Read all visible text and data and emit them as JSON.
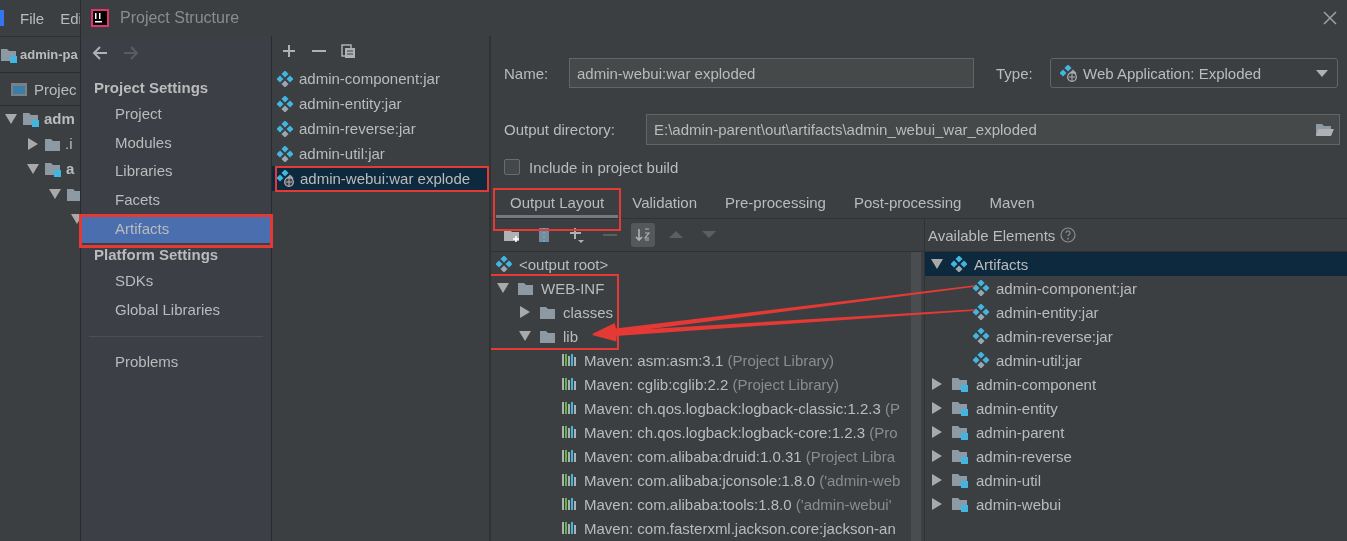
{
  "ide_background": {
    "menu": [
      "File",
      "Edi"
    ],
    "project_name": "admin-pa",
    "tool_window": "Projec",
    "tree": [
      {
        "label": "adm",
        "kind": "module",
        "expanded": true,
        "children": [
          {
            "label": ".i",
            "kind": "folder",
            "expanded": false
          },
          {
            "label": "a",
            "kind": "module",
            "expanded": true,
            "children": [
              {
                "kind": "folder",
                "expanded": true,
                "children": [
                  {
                    "expanded": true
                  }
                ]
              }
            ]
          }
        ]
      }
    ]
  },
  "dialog": {
    "title": "Project Structure"
  },
  "sidebar": {
    "nav": [
      {
        "kind": "back",
        "disabled": false
      },
      {
        "kind": "forward",
        "disabled": true
      }
    ],
    "sections": [
      {
        "heading": "Project Settings",
        "items": [
          {
            "label": "Project",
            "selected": false,
            "highlighted": false
          },
          {
            "label": "Modules",
            "selected": false,
            "highlighted": false
          },
          {
            "label": "Libraries",
            "selected": false,
            "highlighted": false
          },
          {
            "label": "Facets",
            "selected": false,
            "highlighted": false
          },
          {
            "label": "Artifacts",
            "selected": true,
            "highlighted": true
          }
        ]
      },
      {
        "heading": "Platform Settings",
        "items": [
          {
            "label": "SDKs",
            "selected": false,
            "highlighted": false
          },
          {
            "label": "Global Libraries",
            "selected": false,
            "highlighted": false
          }
        ]
      },
      {
        "items": [
          {
            "label": "Problems",
            "selected": false,
            "highlighted": false
          }
        ]
      }
    ]
  },
  "artifacts": {
    "toolbar": [
      {
        "kind": "add"
      },
      {
        "kind": "remove"
      },
      {
        "kind": "copy"
      }
    ],
    "items": [
      {
        "label": "admin-component:jar",
        "kind": "jar",
        "selected": false,
        "highlighted": false
      },
      {
        "label": "admin-entity:jar",
        "kind": "jar",
        "selected": false,
        "highlighted": false
      },
      {
        "label": "admin-reverse:jar",
        "kind": "jar",
        "selected": false,
        "highlighted": false
      },
      {
        "label": "admin-util:jar",
        "kind": "jar",
        "selected": false,
        "highlighted": false
      },
      {
        "label": "admin-webui:war explode",
        "kind": "war",
        "selected": true,
        "highlighted": true
      }
    ]
  },
  "editor": {
    "name_label": "Name:",
    "name": "admin-webui:war exploded",
    "type_label": "Type:",
    "type": "Web Application: Exploded",
    "output_label": "Output directory:",
    "output_directory": "E:\\admin-parent\\out\\artifacts\\admin_webui_war_exploded",
    "include_label": "Include in project build",
    "include_checked": false,
    "tabs": [
      {
        "label": "Output Layout",
        "selected": true,
        "highlighted": true
      },
      {
        "label": "Validation",
        "selected": false,
        "highlighted": false
      },
      {
        "label": "Pre-processing",
        "selected": false,
        "highlighted": false
      },
      {
        "label": "Post-processing",
        "selected": false,
        "highlighted": false
      },
      {
        "label": "Maven",
        "selected": false,
        "highlighted": false
      }
    ],
    "layout_toolbar": [
      {
        "kind": "new-folder",
        "disabled": false,
        "on": false
      },
      {
        "kind": "archive",
        "disabled": false,
        "on": false
      },
      {
        "kind": "add",
        "disabled": false,
        "on": false
      },
      {
        "kind": "remove",
        "disabled": true,
        "on": false
      },
      {
        "kind": "sort",
        "disabled": false,
        "on": true
      },
      {
        "kind": "up",
        "disabled": true,
        "on": false
      },
      {
        "kind": "down",
        "disabled": true,
        "on": false
      }
    ],
    "available_label": "Available Elements",
    "layout_tree": [
      {
        "label": "<output root>",
        "kind": "artifact",
        "selected": false,
        "highlighted": false
      },
      {
        "label": "WEB-INF",
        "kind": "folder",
        "expanded": true,
        "selected": false,
        "highlighted": true,
        "children": [
          {
            "label": "classes",
            "kind": "folder",
            "expanded": false,
            "selected": false,
            "highlighted": true
          },
          {
            "label": "lib",
            "kind": "folder",
            "expanded": true,
            "selected": false,
            "highlighted": true,
            "children": [
              {
                "label": "Maven: asm:asm:3.1",
                "detail": "(Project Library)",
                "kind": "library",
                "selected": false,
                "highlighted": false
              },
              {
                "label": "Maven: cglib:cglib:2.2",
                "detail": "(Project Library)",
                "kind": "library",
                "selected": false,
                "highlighted": false
              },
              {
                "label": "Maven: ch.qos.logback:logback-classic:1.2.3",
                "detail": "(P",
                "kind": "library",
                "selected": false,
                "highlighted": false
              },
              {
                "label": "Maven: ch.qos.logback:logback-core:1.2.3",
                "detail": "(Pro",
                "kind": "library",
                "selected": false,
                "highlighted": false
              },
              {
                "label": "Maven: com.alibaba:druid:1.0.31",
                "detail": "(Project Libra",
                "kind": "library",
                "selected": false,
                "highlighted": false
              },
              {
                "label": "Maven: com.alibaba:jconsole:1.8.0",
                "detail": "('admin-web",
                "kind": "library",
                "selected": false,
                "highlighted": false
              },
              {
                "label": "Maven: com.alibaba:tools:1.8.0",
                "detail": "('admin-webui'",
                "kind": "library",
                "selected": false,
                "highlighted": false
              },
              {
                "label": "Maven: com.fasterxml.jackson.core:jackson-an",
                "kind": "library",
                "selected": false,
                "highlighted": false
              }
            ]
          }
        ]
      }
    ],
    "available_tree": [
      {
        "label": "Artifacts",
        "kind": "artifact",
        "expanded": true,
        "selected": true,
        "children": [
          {
            "label": "admin-component:jar",
            "kind": "artifact",
            "selected": false
          },
          {
            "label": "admin-entity:jar",
            "kind": "artifact",
            "selected": false
          },
          {
            "label": "admin-reverse:jar",
            "kind": "artifact",
            "selected": false
          },
          {
            "label": "admin-util:jar",
            "kind": "artifact",
            "selected": false
          }
        ]
      },
      {
        "label": "admin-component",
        "kind": "module",
        "expanded": false,
        "selected": false
      },
      {
        "label": "admin-entity",
        "kind": "module",
        "expanded": false,
        "selected": false
      },
      {
        "label": "admin-parent",
        "kind": "module",
        "expanded": false,
        "selected": false
      },
      {
        "label": "admin-reverse",
        "kind": "module",
        "expanded": false,
        "selected": false
      },
      {
        "label": "admin-util",
        "kind": "module",
        "expanded": false,
        "selected": false
      },
      {
        "label": "admin-webui",
        "kind": "module",
        "expanded": false,
        "selected": false
      }
    ]
  }
}
